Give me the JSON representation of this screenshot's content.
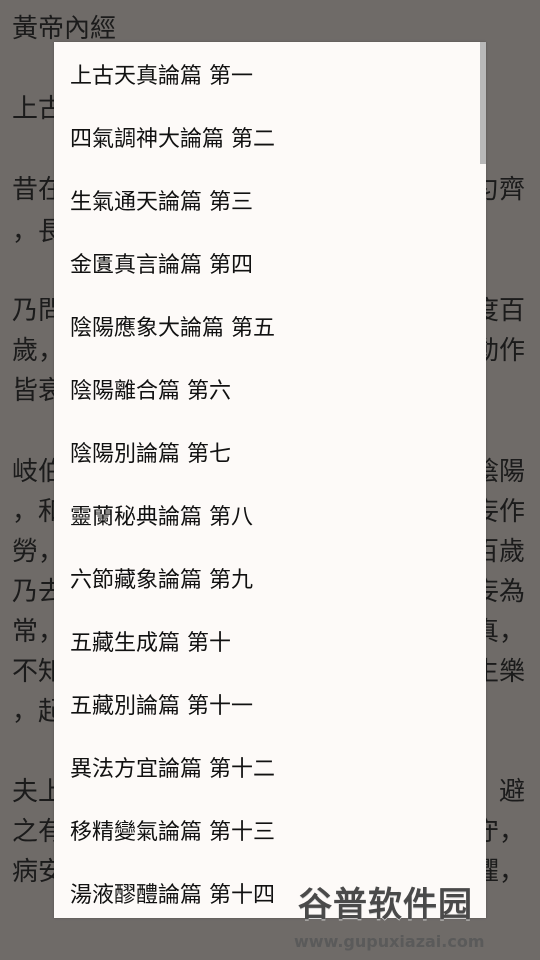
{
  "reader": {
    "book_title": "黃帝內經",
    "chapter_title": "上古",
    "text_fragments": [
      "昔在",
      "匀齊",
      "，長",
      "乃問",
      "度百",
      "歲，",
      "動作",
      "皆衰",
      "岐伯",
      "陰陽",
      "，和",
      "妄作",
      "勞，",
      "百歲",
      "乃去",
      "妄為",
      "常，",
      "真，",
      "不知",
      "生樂",
      "，起",
      "夫上",
      "避",
      "之有",
      "守，",
      "病安",
      "懼，"
    ]
  },
  "menu": {
    "items": [
      "上古天真論篇 第一",
      "四氣調神大論篇 第二",
      "生氣通天論篇 第三",
      "金匱真言論篇 第四",
      "陰陽應象大論篇 第五",
      "陰陽離合篇 第六",
      "陰陽別論篇 第七",
      "靈蘭秘典論篇 第八",
      "六節藏象論篇 第九",
      "五藏生成篇 第十",
      "五藏別論篇 第十一",
      "異法方宜論篇 第十二",
      "移精變氣論篇 第十三",
      "湯液醪醴論篇 第十四"
    ]
  },
  "watermark": {
    "logo": "谷普软件园",
    "url": "www.gupuxiazai.com"
  }
}
